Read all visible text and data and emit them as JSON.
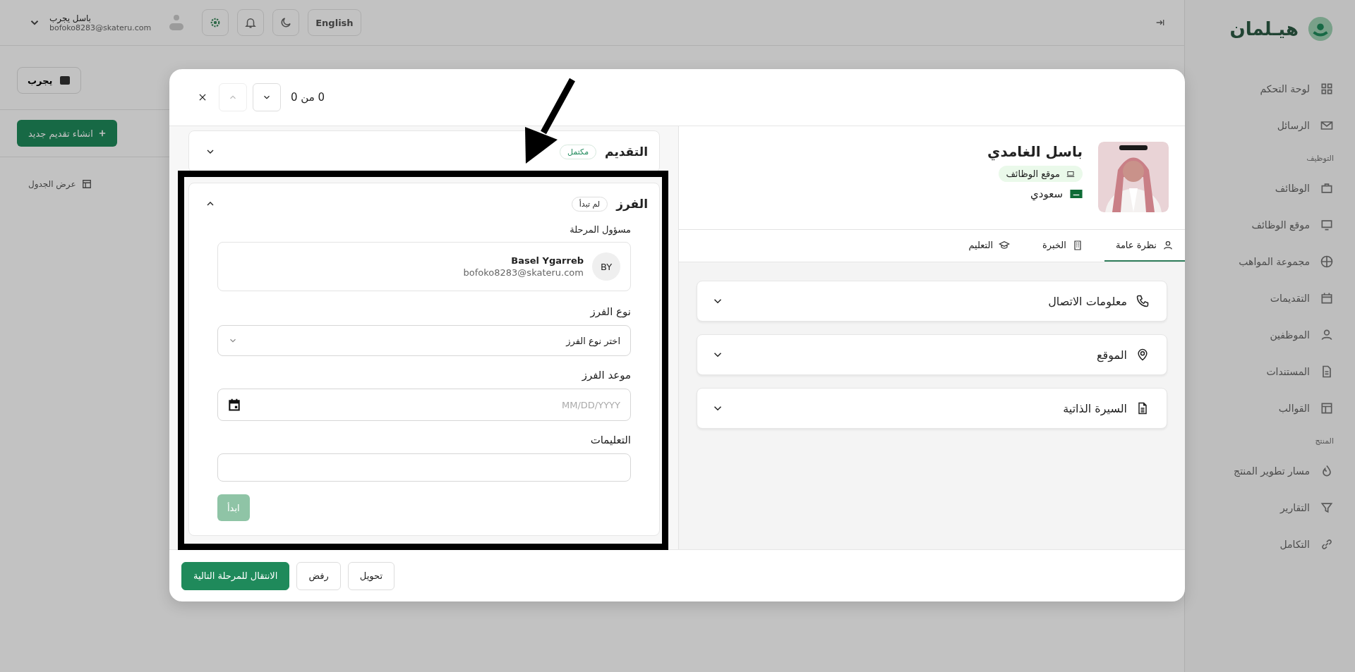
{
  "app": {
    "logo": "هيـلمان",
    "sidebar": [
      {
        "items": [
          "لوحة التحكم",
          "الرسائل"
        ]
      },
      {
        "section": "التوظيف",
        "items": [
          "الوظائف",
          "موقع الوظائف",
          "مجموعة المواهب",
          "التقديمات",
          "الموظفين",
          "المستندات",
          "القوالب"
        ]
      },
      {
        "section": "المنتج",
        "items": [
          "مسار تطوير المنتج",
          "التقارير",
          "التكامل"
        ]
      }
    ],
    "topbar": {
      "language": "English",
      "user_name": "باسل يجرب",
      "user_email": "bofoko8283@skateru.com"
    },
    "toolbar": {
      "workspace": "يجرب",
      "create_button": "انشاء تقديم جديد",
      "view_button": "عرض الجدول"
    }
  },
  "modal": {
    "counter": "0 من 0",
    "prev_disabled": true,
    "next_disabled": false,
    "profile": {
      "name": "باسل الغامدي",
      "source": "موقع الوظائف",
      "nationality": "سعودي"
    },
    "tabs": [
      {
        "label": "نظرة عامة",
        "selected": true
      },
      {
        "label": "الخبرة",
        "selected": false
      },
      {
        "label": "التعليم",
        "selected": false
      }
    ],
    "sections": [
      {
        "title": "معلومات الاتصال",
        "expanded": false
      },
      {
        "title": "الموقع",
        "expanded": false
      },
      {
        "title": "السيرة الذاتية",
        "expanded": false
      }
    ],
    "stages": [
      {
        "title": "التقديم",
        "badge": {
          "text": "مكتمل",
          "kind": "done"
        },
        "expanded": false
      },
      {
        "title": "الفرز",
        "badge": {
          "text": "لم تبدأ",
          "kind": "pending"
        },
        "expanded": true,
        "owner_label": "مسؤول المرحلة",
        "owner": {
          "initials": "BY",
          "name": "Basel Ygarreb",
          "email": "bofoko8283@skateru.com"
        },
        "fields": [
          {
            "kind": "select",
            "label": "نوع الفرز",
            "placeholder": "اختر نوع الفرز"
          },
          {
            "kind": "date",
            "label": "موعد الفرز",
            "placeholder": "MM/DD/YYYY"
          },
          {
            "kind": "text",
            "label": "التعليمات"
          }
        ],
        "action": {
          "label": "ابدأ",
          "disabled": true
        }
      }
    ],
    "footer_buttons": [
      {
        "label": "تحويل",
        "kind": "secondary"
      },
      {
        "label": "رفض",
        "kind": "secondary"
      },
      {
        "label": "الانتقال للمرحلة التالية",
        "kind": "primary"
      }
    ]
  }
}
